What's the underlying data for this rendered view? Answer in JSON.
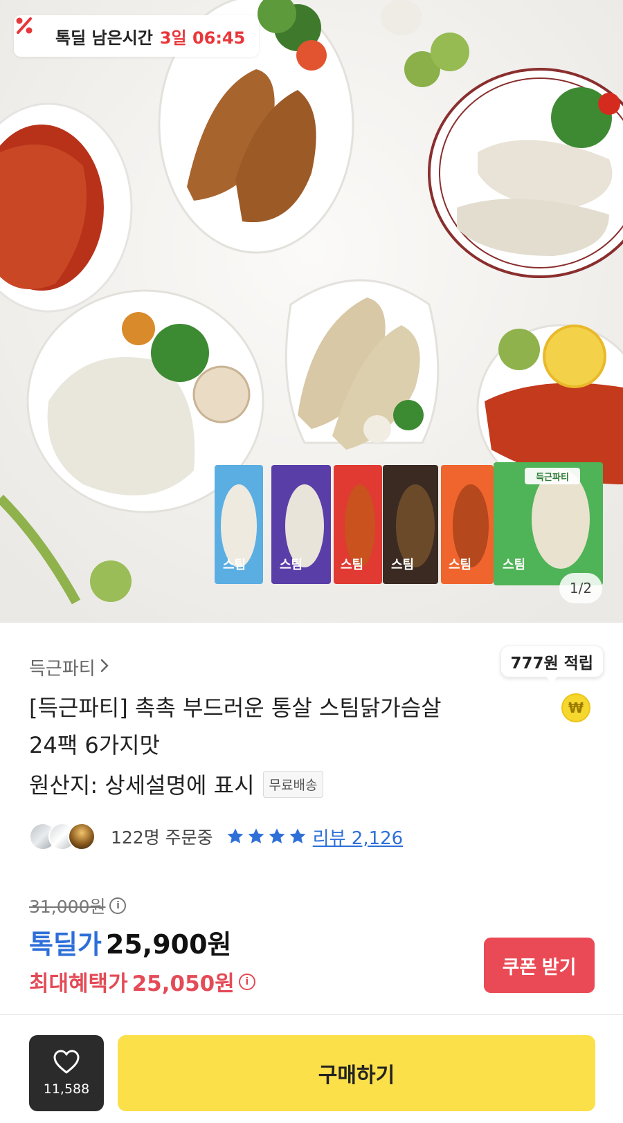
{
  "hero": {
    "timer_label": "톡딜 남은시간",
    "timer_value": "3일 06:45",
    "image_counter": "1/2",
    "package_labels": [
      "스팀",
      "스팀",
      "스팀",
      "스팀",
      "스팀",
      "스팀"
    ],
    "brand_on_package": "득근파티"
  },
  "product": {
    "brand": "득근파티",
    "reward": "777원 적립",
    "coin_symbol": "₩",
    "title_line1": "[득근파티] 촉촉 부드러운 통살 스팀닭가슴살",
    "title_line2": "24팩 6가지맛",
    "origin": "원산지: 상세설명에 표시",
    "free_shipping": "무료배송",
    "orders": "122명 주문중",
    "rating_stars": 4,
    "review": "리뷰 2,126"
  },
  "price": {
    "original": "31,000원",
    "deal_label": "톡딜가",
    "deal_price": "25,900원",
    "best_label": "최대혜택가",
    "best_price": "25,050원",
    "coupon_button": "쿠폰 받기"
  },
  "bottom_bar": {
    "like_count": "11,588",
    "buy_button": "구매하기"
  },
  "colors": {
    "accent_blue": "#2e6fd8",
    "accent_red": "#e34b57",
    "buy_yellow": "#fbe04a",
    "timer_red": "#e8373a"
  }
}
